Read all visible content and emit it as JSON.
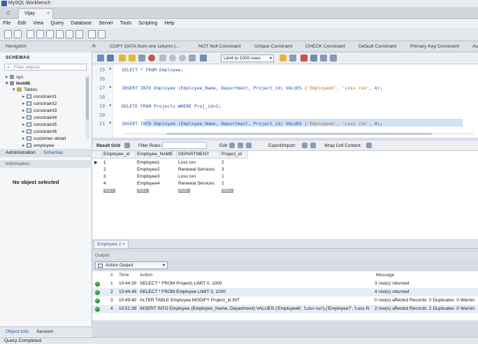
{
  "window": {
    "title": "MySQL Workbench"
  },
  "connection_tab": {
    "label": "Vijay"
  },
  "menu": [
    "File",
    "Edit",
    "View",
    "Query",
    "Database",
    "Server",
    "Tools",
    "Scripting",
    "Help"
  ],
  "navigator": {
    "header": "Navigator",
    "schemas_label": "SCHEMAS",
    "filter_placeholder": "Filter objects",
    "tree": {
      "sys": "sys",
      "testdb": "testdb",
      "tables": "Tables",
      "items": [
        "constraint1",
        "constraint2",
        "constraint3",
        "constraint4",
        "constraint5",
        "constraint6",
        "customer detail",
        "employee"
      ]
    },
    "tabs": {
      "administration": "Administration",
      "schemas": "Schemas"
    },
    "information_header": "Information",
    "no_object": "No object selected",
    "bottom_tabs": {
      "object_info": "Object Info",
      "session": "Session"
    }
  },
  "query_tabs": [
    "R",
    "COPY DATA from one column t...",
    "NOT Null Constraint",
    "Unique Constraint",
    "CHECK Constraint",
    "Default Constraint",
    "Primary Key Constraint",
    "Au"
  ],
  "limit": {
    "value": "Limit to 1000 rows"
  },
  "editor": {
    "lines": [
      {
        "num": "15",
        "code": "SELECT * FROM Employee;"
      },
      {
        "num": "16",
        "code": ""
      },
      {
        "num": "17",
        "code": "INSERT INTO Employee (Employee_Name, Department, Project_id) VALUES (",
        "str": "'Employee5', 'Loss run'",
        "tail": ", 4);"
      },
      {
        "num": "18",
        "code": ""
      },
      {
        "num": "19",
        "code": "DELETE FROM Projects WHERE Proj_id=2;"
      },
      {
        "num": "20",
        "code": ""
      },
      {
        "num": "21",
        "code": "INSERT INTO Employee (Employee_Name, Department, Project_id) VALUES (",
        "str": "'Employee6', 'Loss run'",
        "tail": ", 4);"
      }
    ]
  },
  "result_toolbar": {
    "result_grid": "Result Grid",
    "filter_rows": "Filter Rows:",
    "edit": "Edit:",
    "export_import": "Export/Import:",
    "wrap_cell": "Wrap Cell Content:"
  },
  "grid": {
    "columns": [
      "Employee_id",
      "Employee_NAME",
      "DEPARTMENT",
      "Project_id"
    ],
    "rows": [
      [
        "1",
        "Employee1",
        "Loss run",
        "2"
      ],
      [
        "2",
        "Employee2",
        "Renewal Services",
        "3"
      ],
      [
        "3",
        "Employee3",
        "Loss run",
        "1"
      ],
      [
        "4",
        "Employee4",
        "Renewal Services",
        "2"
      ]
    ],
    "null_label": "NULL"
  },
  "result_tab": {
    "label": "Employee 2"
  },
  "output": {
    "header": "Output",
    "selector": "Action Output",
    "columns": {
      "num": "#",
      "time": "Time",
      "action": "Action",
      "message": "Message"
    },
    "rows": [
      {
        "num": "1",
        "time": "10:44:30",
        "action": "SELECT * FROM Projects LIMIT 0, 1000",
        "message": "3 row(s) returned"
      },
      {
        "num": "2",
        "time": "10:44:49",
        "action": "SELECT * FROM Employee LIMIT 0, 1000",
        "message": "4 row(s) returned"
      },
      {
        "num": "3",
        "time": "10:49:40",
        "action": "ALTER TABLE Employee MODIFY Project_id INT",
        "message": "0 row(s) affected Records: 0  Duplicates: 0  Warnin"
      },
      {
        "num": "4",
        "time": "10:51:39",
        "action": "INSERT INTO Employee (Employee_Name, Department) VALUES ('Employee6', 'Loss run'),('Employee7', 'Loss R...",
        "message": "2 row(s) affected Records: 2  Duplicates: 0  Warnin"
      }
    ]
  },
  "status": {
    "text": "Query Completed"
  }
}
